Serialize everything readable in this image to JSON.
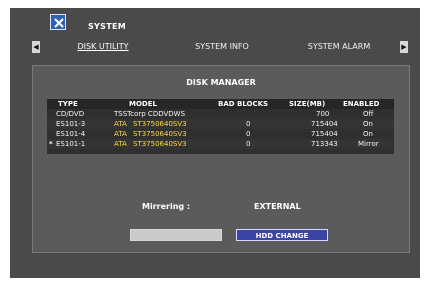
{
  "header": {
    "title": "SYSTEM"
  },
  "tabs": [
    {
      "label": "DISK UTILITY",
      "active": true
    },
    {
      "label": "SYSTEM INFO",
      "active": false
    },
    {
      "label": "SYSTEM ALARM",
      "active": false
    }
  ],
  "panel": {
    "title": "DISK MANAGER",
    "columns": [
      "TYPE",
      "MODEL",
      "BAD BLOCKS",
      "SIZE(MB)",
      "ENABLED"
    ],
    "rows": [
      {
        "selected_mark": "",
        "type": "CD/DVD",
        "vendor": "",
        "model": "TSSTcorp CDDVDWS",
        "bad_blocks": "",
        "size": "700",
        "enabled": "Off"
      },
      {
        "selected_mark": "",
        "type": "ES101-3",
        "vendor": "ATA",
        "model": "ST3750640SV3",
        "bad_blocks": "0",
        "size": "715404",
        "enabled": "On"
      },
      {
        "selected_mark": "",
        "type": "ES101-4",
        "vendor": "ATA",
        "model": "ST3750640SV3",
        "bad_blocks": "0",
        "size": "715404",
        "enabled": "On"
      },
      {
        "selected_mark": "*",
        "type": "ES101-1",
        "vendor": "ATA",
        "model": "ST3750640SV3",
        "bad_blocks": "0",
        "size": "713343",
        "enabled": "Mirror"
      }
    ],
    "mirroring_label": "Mirrering :",
    "mirroring_value": "EXTERNAL",
    "buttons": {
      "disabled_label": "",
      "hdd_change_label": "HDD CHANGE"
    }
  },
  "icons": {
    "system": "tools-icon",
    "left_arrow": "left-arrow-icon",
    "right_arrow": "right-arrow-icon"
  },
  "colors": {
    "background": "#4a4a4a",
    "panel": "#5b5b5b",
    "table": "#2f2f2f",
    "accent_button": "#3c45a6",
    "vendor_text": "#ffd84a"
  }
}
